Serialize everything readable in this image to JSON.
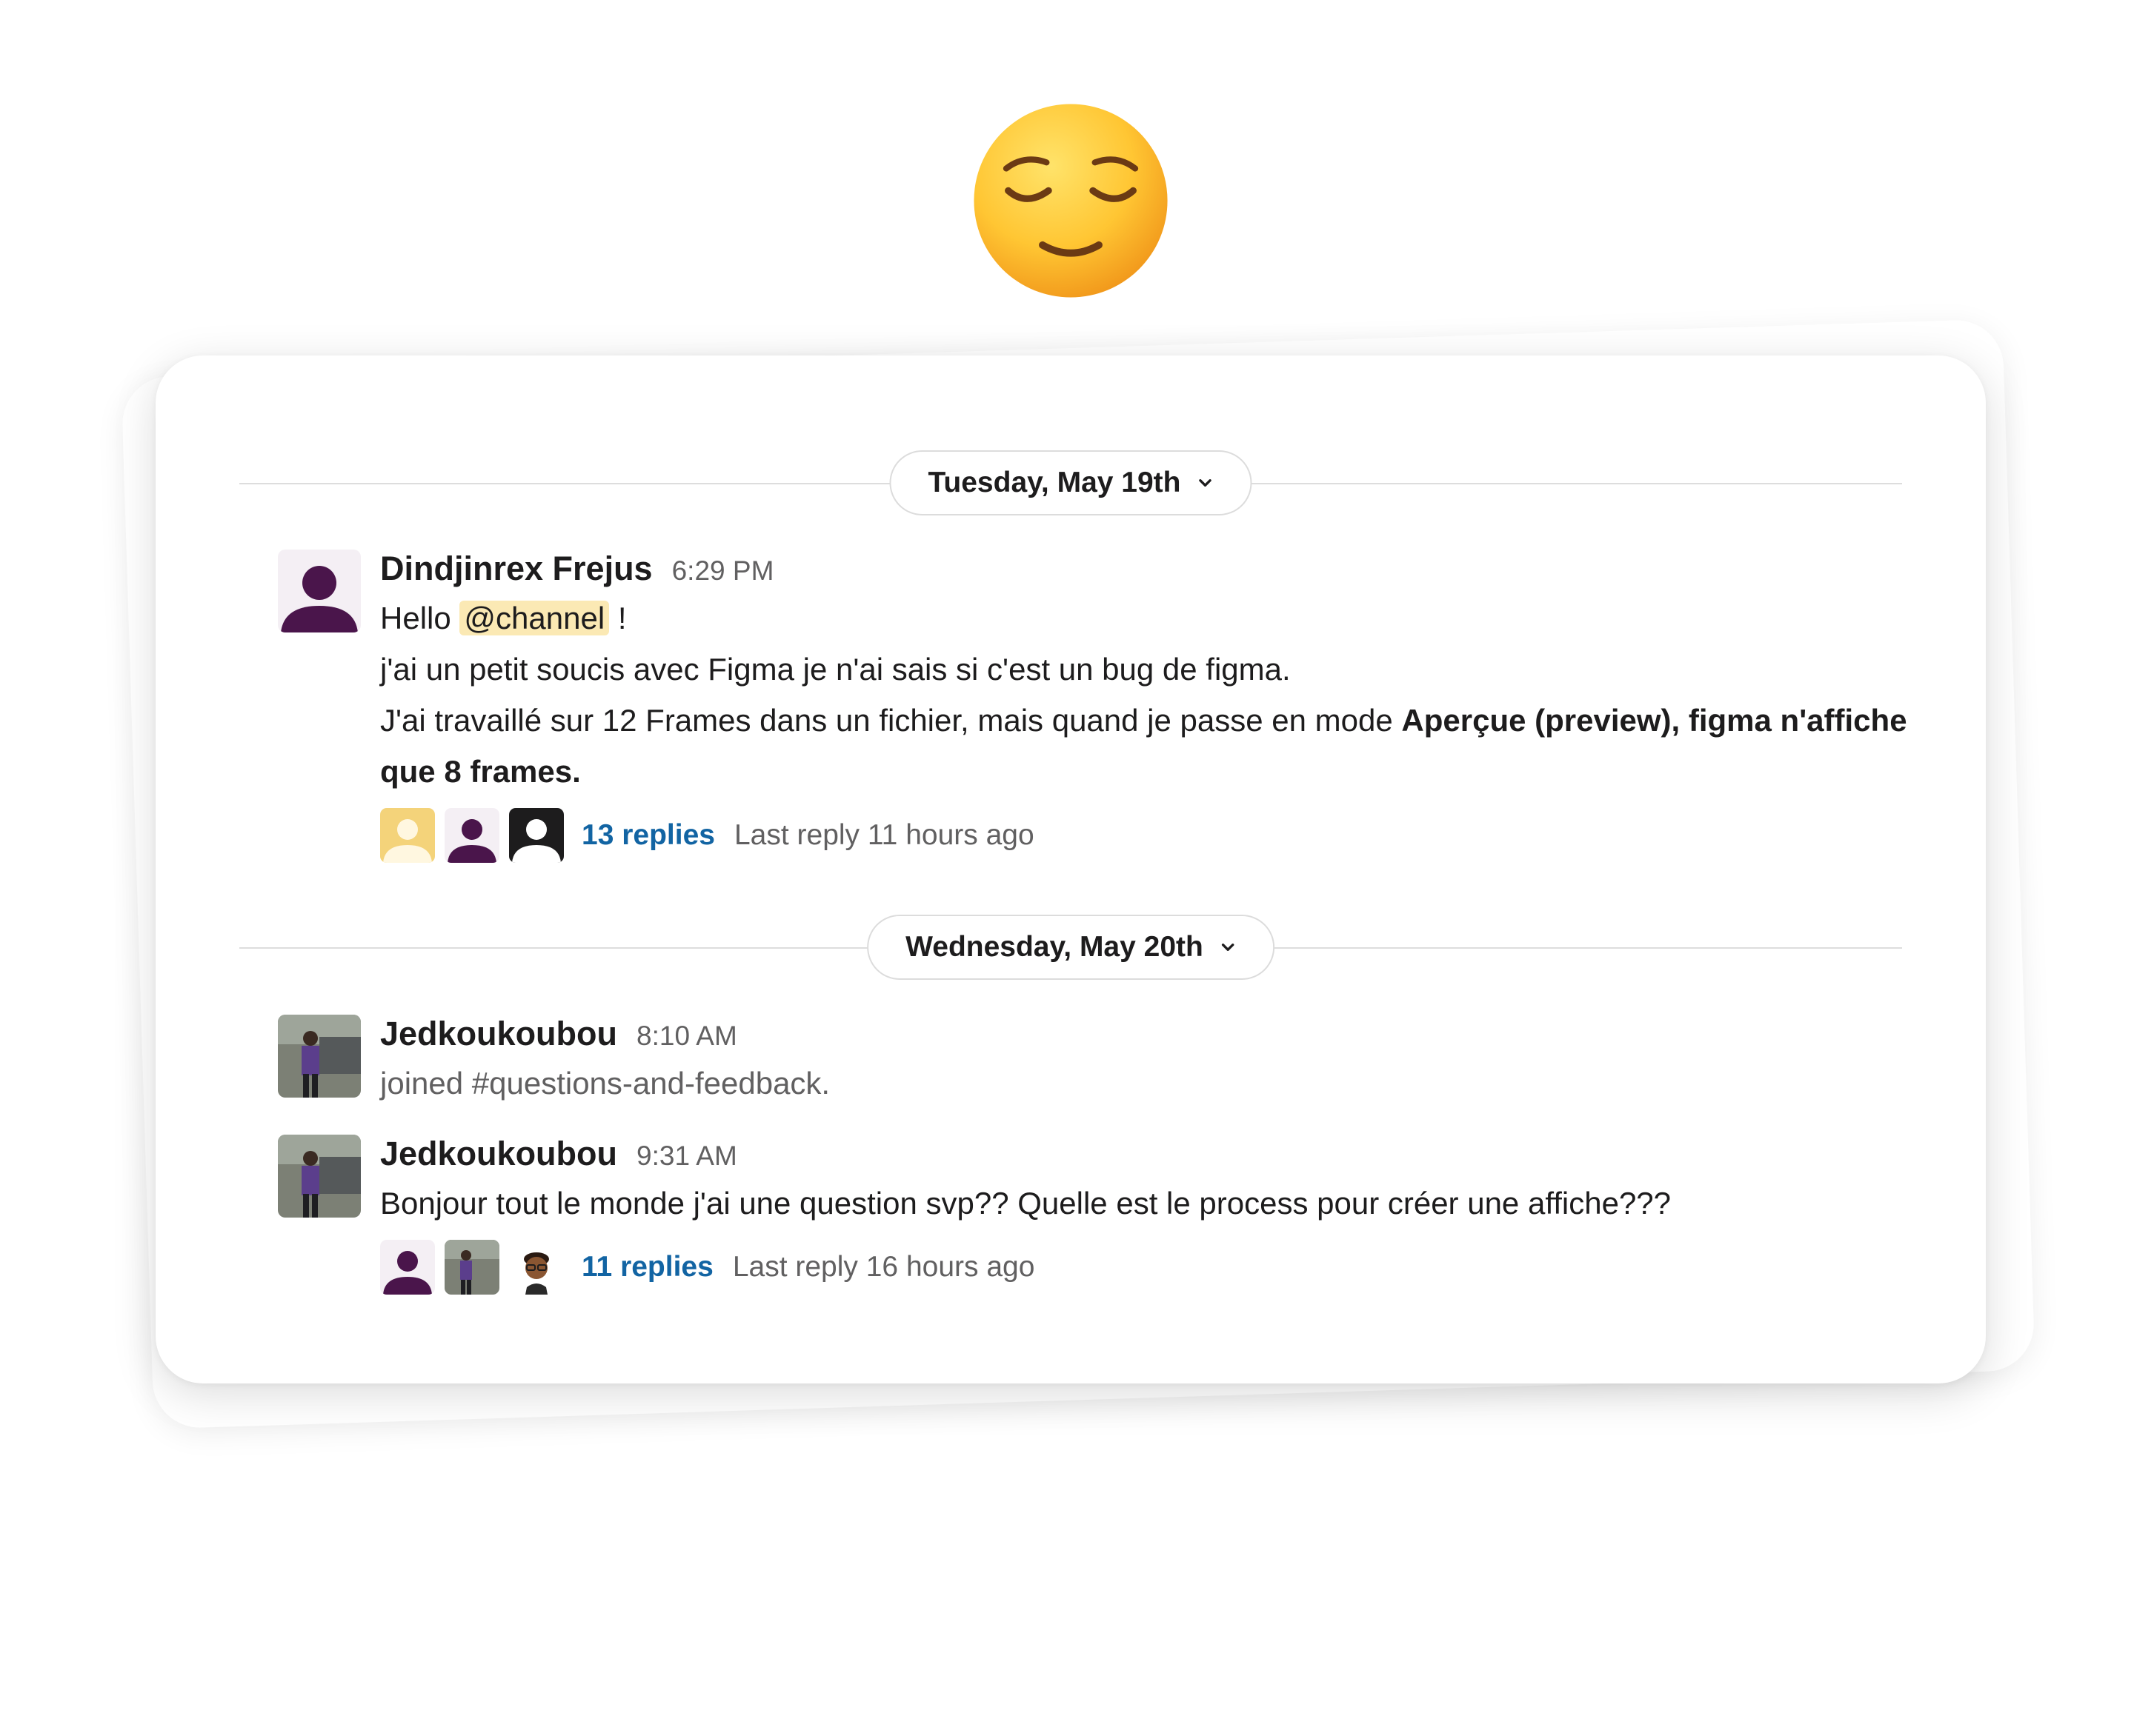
{
  "header_emoji": "relieved-face",
  "dividers": [
    {
      "label": "Tuesday, May 19th"
    },
    {
      "label": "Wednesday, May 20th"
    }
  ],
  "messages": [
    {
      "author": "Dindjinrex Frejus",
      "time": "6:29 PM",
      "greeting": "Hello",
      "mention": "@channel",
      "greeting_end": "!",
      "line2": "j'ai un petit soucis avec Figma je n'ai sais si c'est un bug de figma.",
      "line3_regular": "J'ai travaillé sur 12 Frames dans un fichier, mais  quand je passe en mode",
      "line3_bold": "Aperçue (preview), figma n'affiche que 8 frames.",
      "thread": {
        "replies": "13 replies",
        "last_reply": "Last reply 11 hours ago"
      }
    },
    {
      "author": "Jedkoukoubou",
      "time": "8:10 AM",
      "text": "joined #questions-and-feedback."
    },
    {
      "author": "Jedkoukoubou",
      "time": "9:31 AM",
      "text": "Bonjour tout le monde j'ai une question svp?? Quelle est le process pour créer une affiche???",
      "thread": {
        "replies": "11 replies",
        "last_reply": "Last reply 16 hours ago"
      }
    }
  ],
  "colors": {
    "accent_link": "#1264a3",
    "mention_bg": "#fbe9b4",
    "avatar_purple": "#4a154b",
    "muted_text": "#616061"
  }
}
